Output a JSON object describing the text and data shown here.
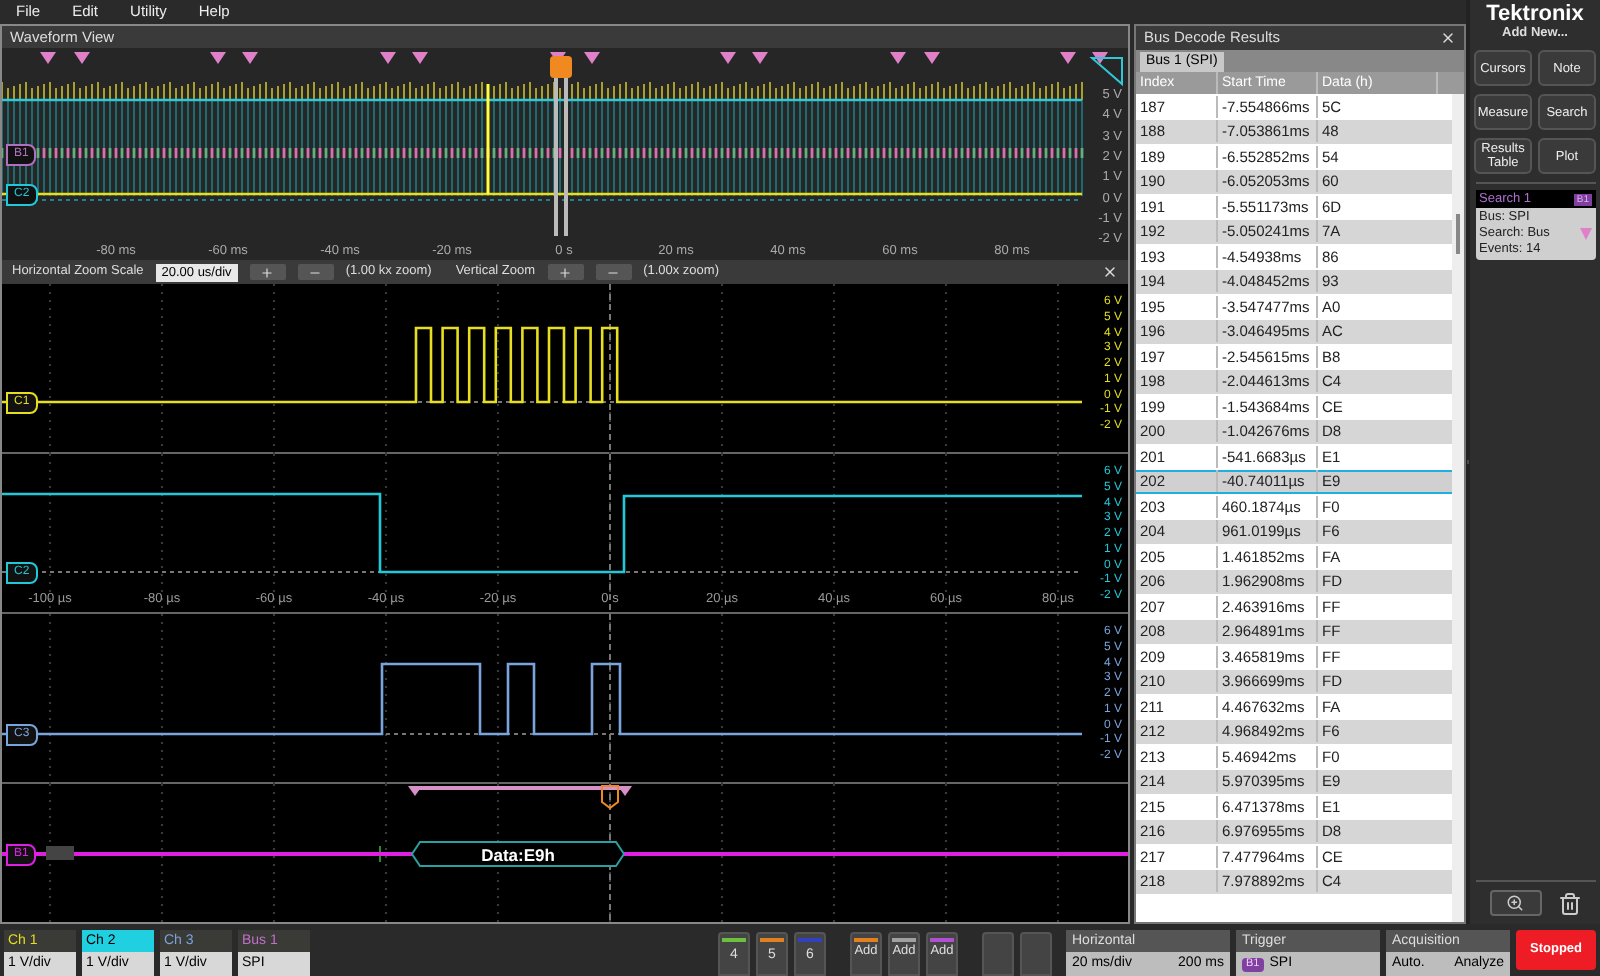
{
  "menu": [
    "File",
    "Edit",
    "Utility",
    "Help"
  ],
  "waveform_view": {
    "title": "Waveform View",
    "overview": {
      "volt_labels": [
        "5 V",
        "4 V",
        "3 V",
        "2 V",
        "1 V",
        "0 V",
        "-1 V",
        "-2 V"
      ],
      "time_labels": [
        "-80 ms",
        "-60 ms",
        "-40 ms",
        "-20 ms",
        "0 s",
        "20 ms",
        "40 ms",
        "60 ms",
        "80 ms"
      ],
      "badges": [
        {
          "label": "B1",
          "color": "#b070c0"
        },
        {
          "label": "C2",
          "color": "#20c8d8"
        }
      ]
    },
    "zoom_toolbar": {
      "horizontal_label": "Horizontal Zoom Scale",
      "horizontal_value": "20.00 us/div",
      "horizontal_zoom": "(1.00 kx zoom)",
      "vertical_label": "Vertical Zoom",
      "vertical_zoom": "(1.00x zoom)"
    },
    "channels": [
      {
        "kind": "clock",
        "badge": "C1",
        "color": "#e6de1e",
        "volt_labels": [
          "6 V",
          "5 V",
          "4 V",
          "3 V",
          "2 V",
          "1 V",
          "0 V",
          "-1 V",
          "-2 V"
        ]
      },
      {
        "kind": "select",
        "badge": "C2",
        "color": "#20c8d8",
        "volt_labels": [
          "6 V",
          "5 V",
          "4 V",
          "3 V",
          "2 V",
          "1 V",
          "0 V",
          "-1 V",
          "-2 V"
        ],
        "time_labels": [
          "-100 µs",
          "-80 µs",
          "-60 µs",
          "-40 µs",
          "-20 µs",
          "0 s",
          "20 µs",
          "40 µs",
          "60 µs",
          "80 µs"
        ]
      },
      {
        "kind": "data",
        "badge": "C3",
        "color": "#7aa4dc",
        "volt_labels": [
          "6 V",
          "5 V",
          "4 V",
          "3 V",
          "2 V",
          "1 V",
          "0 V",
          "-1 V",
          "-2 V"
        ]
      }
    ],
    "bus": {
      "badge": "B1",
      "color": "#e020e0",
      "packet": "Data:E9h"
    }
  },
  "decode": {
    "title": "Bus Decode Results",
    "tab": "Bus 1 (SPI)",
    "columns": [
      "Index",
      "Start Time",
      "Data (h)"
    ],
    "rows": [
      {
        "index": "187",
        "start_time": "-7.554866ms",
        "data": "5C",
        "selected": false
      },
      {
        "index": "188",
        "start_time": "-7.053861ms",
        "data": "48",
        "selected": false
      },
      {
        "index": "189",
        "start_time": "-6.552852ms",
        "data": "54",
        "selected": false
      },
      {
        "index": "190",
        "start_time": "-6.052053ms",
        "data": "60",
        "selected": false
      },
      {
        "index": "191",
        "start_time": "-5.551173ms",
        "data": "6D",
        "selected": false
      },
      {
        "index": "192",
        "start_time": "-5.050241ms",
        "data": "7A",
        "selected": false
      },
      {
        "index": "193",
        "start_time": "-4.54938ms",
        "data": "86",
        "selected": false
      },
      {
        "index": "194",
        "start_time": "-4.048452ms",
        "data": "93",
        "selected": false
      },
      {
        "index": "195",
        "start_time": "-3.547477ms",
        "data": "A0",
        "selected": false
      },
      {
        "index": "196",
        "start_time": "-3.046495ms",
        "data": "AC",
        "selected": false
      },
      {
        "index": "197",
        "start_time": "-2.545615ms",
        "data": "B8",
        "selected": false
      },
      {
        "index": "198",
        "start_time": "-2.044613ms",
        "data": "C4",
        "selected": false
      },
      {
        "index": "199",
        "start_time": "-1.543684ms",
        "data": "CE",
        "selected": false
      },
      {
        "index": "200",
        "start_time": "-1.042676ms",
        "data": "D8",
        "selected": false
      },
      {
        "index": "201",
        "start_time": "-541.6683µs",
        "data": "E1",
        "selected": false
      },
      {
        "index": "202",
        "start_time": "-40.74011µs",
        "data": "E9",
        "selected": true
      },
      {
        "index": "203",
        "start_time": "460.1874µs",
        "data": "F0",
        "selected": false
      },
      {
        "index": "204",
        "start_time": "961.0199µs",
        "data": "F6",
        "selected": false
      },
      {
        "index": "205",
        "start_time": "1.461852ms",
        "data": "FA",
        "selected": false
      },
      {
        "index": "206",
        "start_time": "1.962908ms",
        "data": "FD",
        "selected": false
      },
      {
        "index": "207",
        "start_time": "2.463916ms",
        "data": "FF",
        "selected": false
      },
      {
        "index": "208",
        "start_time": "2.964891ms",
        "data": "FF",
        "selected": false
      },
      {
        "index": "209",
        "start_time": "3.465819ms",
        "data": "FF",
        "selected": false
      },
      {
        "index": "210",
        "start_time": "3.966699ms",
        "data": "FD",
        "selected": false
      },
      {
        "index": "211",
        "start_time": "4.467632ms",
        "data": "FA",
        "selected": false
      },
      {
        "index": "212",
        "start_time": "4.968492ms",
        "data": "F6",
        "selected": false
      },
      {
        "index": "213",
        "start_time": "5.46942ms",
        "data": "F0",
        "selected": false
      },
      {
        "index": "214",
        "start_time": "5.970395ms",
        "data": "E9",
        "selected": false
      },
      {
        "index": "215",
        "start_time": "6.471378ms",
        "data": "E1",
        "selected": false
      },
      {
        "index": "216",
        "start_time": "6.976955ms",
        "data": "D8",
        "selected": false
      },
      {
        "index": "217",
        "start_time": "7.477964ms",
        "data": "CE",
        "selected": false
      },
      {
        "index": "218",
        "start_time": "7.978892ms",
        "data": "C4",
        "selected": false
      }
    ]
  },
  "sidebar": {
    "logo": "Tektronix",
    "add_new": "Add New...",
    "buttons": [
      "Cursors",
      "Note",
      "Measure",
      "Search",
      "Results Table",
      "Plot"
    ],
    "search_card": {
      "title": "Search 1",
      "badge": "B1",
      "lines": [
        "Bus: SPI",
        "Search: Bus",
        "Events: 14"
      ]
    }
  },
  "bottom_bar": {
    "channels": [
      {
        "label": "Ch 1",
        "value": "1 V/div",
        "color": "#e6de1e",
        "selected": false
      },
      {
        "label": "Ch 2",
        "value": "1 V/div",
        "color": "#20d0e0",
        "selected": true
      },
      {
        "label": "Ch 3",
        "value": "1 V/div",
        "color": "#7aa4dc",
        "selected": false
      },
      {
        "label": "Bus 1",
        "value": "SPI",
        "color": "#c070c8",
        "selected": false
      }
    ],
    "slots": [
      {
        "label": "4",
        "color": "#6cc040"
      },
      {
        "label": "5",
        "color": "#e08020"
      },
      {
        "label": "6",
        "color": "#3040c0"
      }
    ],
    "add_buttons": [
      {
        "label": "Add",
        "color": "#e08020"
      },
      {
        "label": "Add",
        "color": "#a0a0a0"
      },
      {
        "label": "Add",
        "color": "#b050d0"
      }
    ],
    "horizontal": {
      "title": "Horizontal",
      "scale": "20 ms/div",
      "position": "200 ms"
    },
    "trigger": {
      "title": "Trigger",
      "source": "B1",
      "type": "SPI"
    },
    "acquisition": {
      "title": "Acquisition",
      "mode": "Auto.",
      "analyze": "Analyze"
    },
    "run_state": "Stopped"
  }
}
